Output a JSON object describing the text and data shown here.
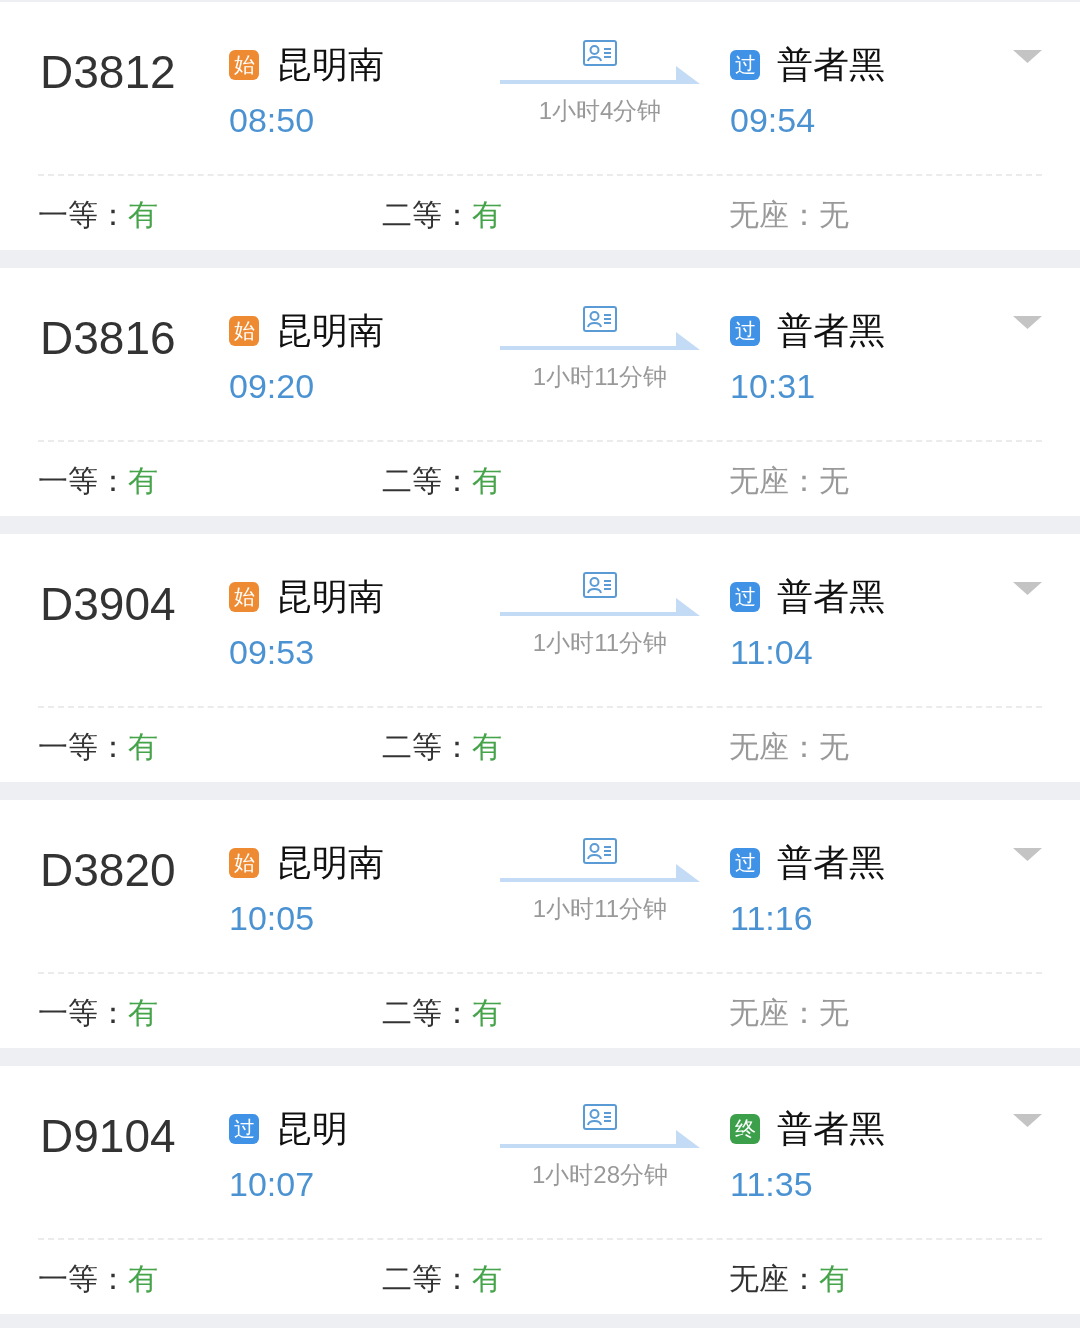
{
  "trains": [
    {
      "number": "D3812",
      "departure": {
        "tag": {
          "kind": "origin",
          "label": "始"
        },
        "station": "昆明南",
        "time": "08:50"
      },
      "duration": "1小时4分钟",
      "arrival": {
        "tag": {
          "kind": "pass",
          "label": "过"
        },
        "station": "普者黑",
        "time": "09:54"
      },
      "seats": [
        {
          "label": "一等：",
          "value": "有",
          "available": true
        },
        {
          "label": "二等：",
          "value": "有",
          "available": true
        },
        {
          "label": "无座：",
          "value": "无",
          "available": false
        }
      ]
    },
    {
      "number": "D3816",
      "departure": {
        "tag": {
          "kind": "origin",
          "label": "始"
        },
        "station": "昆明南",
        "time": "09:20"
      },
      "duration": "1小时11分钟",
      "arrival": {
        "tag": {
          "kind": "pass",
          "label": "过"
        },
        "station": "普者黑",
        "time": "10:31"
      },
      "seats": [
        {
          "label": "一等：",
          "value": "有",
          "available": true
        },
        {
          "label": "二等：",
          "value": "有",
          "available": true
        },
        {
          "label": "无座：",
          "value": "无",
          "available": false
        }
      ]
    },
    {
      "number": "D3904",
      "departure": {
        "tag": {
          "kind": "origin",
          "label": "始"
        },
        "station": "昆明南",
        "time": "09:53"
      },
      "duration": "1小时11分钟",
      "arrival": {
        "tag": {
          "kind": "pass",
          "label": "过"
        },
        "station": "普者黑",
        "time": "11:04"
      },
      "seats": [
        {
          "label": "一等：",
          "value": "有",
          "available": true
        },
        {
          "label": "二等：",
          "value": "有",
          "available": true
        },
        {
          "label": "无座：",
          "value": "无",
          "available": false
        }
      ]
    },
    {
      "number": "D3820",
      "departure": {
        "tag": {
          "kind": "origin",
          "label": "始"
        },
        "station": "昆明南",
        "time": "10:05"
      },
      "duration": "1小时11分钟",
      "arrival": {
        "tag": {
          "kind": "pass",
          "label": "过"
        },
        "station": "普者黑",
        "time": "11:16"
      },
      "seats": [
        {
          "label": "一等：",
          "value": "有",
          "available": true
        },
        {
          "label": "二等：",
          "value": "有",
          "available": true
        },
        {
          "label": "无座：",
          "value": "无",
          "available": false
        }
      ]
    },
    {
      "number": "D9104",
      "departure": {
        "tag": {
          "kind": "pass",
          "label": "过"
        },
        "station": "昆明",
        "time": "10:07"
      },
      "duration": "1小时28分钟",
      "arrival": {
        "tag": {
          "kind": "terminal",
          "label": "终"
        },
        "station": "普者黑",
        "time": "11:35"
      },
      "seats": [
        {
          "label": "一等：",
          "value": "有",
          "available": true
        },
        {
          "label": "二等：",
          "value": "有",
          "available": true
        },
        {
          "label": "无座：",
          "value": "有",
          "available": true
        }
      ]
    }
  ]
}
